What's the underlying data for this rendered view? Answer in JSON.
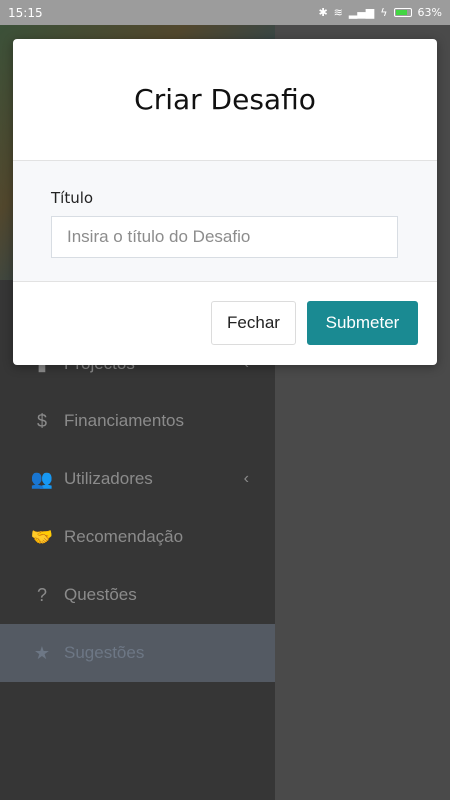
{
  "status_bar": {
    "time": "15:15",
    "battery": "63%"
  },
  "menu": {
    "items": [
      {
        "label": "Projectos",
        "icon": "file-icon",
        "glyph": "▮",
        "chevron": "‹"
      },
      {
        "label": "Financiamentos",
        "icon": "dollar-icon",
        "glyph": "$"
      },
      {
        "label": "Utilizadores",
        "icon": "users-icon",
        "glyph": "👥",
        "chevron": "‹"
      },
      {
        "label": "Recomendação",
        "icon": "handshake-icon",
        "glyph": "🤝"
      },
      {
        "label": "Questões",
        "icon": "question-icon",
        "glyph": "?"
      },
      {
        "label": "Sugestões",
        "icon": "star-icon",
        "glyph": "★"
      }
    ]
  },
  "modal": {
    "title": "Criar Desafio",
    "field_label": "Título",
    "field_placeholder": "Insira o título do Desafio",
    "close_label": "Fechar",
    "submit_label": "Submeter"
  },
  "colors": {
    "accent": "#1a8a92"
  }
}
